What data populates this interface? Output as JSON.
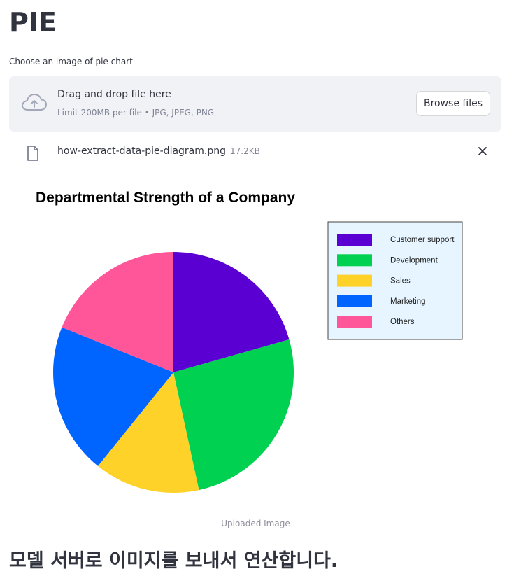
{
  "page": {
    "title": "PIE",
    "result_heading": "모델 서버로 이미지를 보내서 연산합니다."
  },
  "uploader": {
    "label": "Choose an image of pie chart",
    "dropzone_title": "Drag and drop file here",
    "limit_text": "Limit 200MB per file • JPG, JPEG, PNG",
    "browse_label": "Browse files",
    "upload_icon": "cloud-upload-icon"
  },
  "uploaded_file": {
    "name": "how-extract-data-pie-diagram.png",
    "size": "17.2KB",
    "file_icon": "file-icon",
    "remove_icon": "close-icon"
  },
  "image": {
    "caption": "Uploaded Image"
  },
  "chart_data": {
    "type": "pie",
    "title": "Departmental Strength of a Company",
    "legend_position": "right",
    "categories": [
      "Customer support",
      "Development",
      "Sales",
      "Marketing",
      "Others"
    ],
    "values": [
      20.6,
      26.0,
      14.2,
      20.3,
      18.9
    ],
    "colors": [
      "#5b00d2",
      "#00d150",
      "#ffd22a",
      "#0064ff",
      "#ff5599"
    ]
  }
}
